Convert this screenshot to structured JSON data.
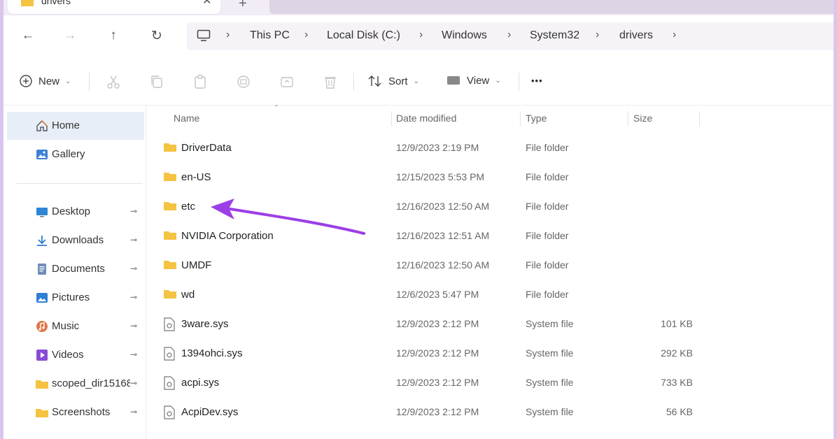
{
  "window": {
    "tab_title": "drivers",
    "tab_close": "✕",
    "tab_new": "+"
  },
  "nav": {
    "back_icon": "←",
    "forward_icon": "→",
    "up_icon": "↑",
    "refresh_icon": "↻",
    "separator": "›",
    "breadcrumbs": [
      "This PC",
      "Local Disk (C:)",
      "Windows",
      "System32",
      "drivers"
    ]
  },
  "toolbar": {
    "new_label": "New",
    "sort_label": "Sort",
    "view_label": "View",
    "more_label": "•••",
    "caret": "⌄"
  },
  "sidebar": {
    "items": [
      {
        "label": "Home",
        "icon": "home-icon",
        "pinned": false
      },
      {
        "label": "Gallery",
        "icon": "gallery-icon",
        "pinned": false
      },
      {
        "label": "Desktop",
        "icon": "desktop-icon",
        "pinned": true
      },
      {
        "label": "Downloads",
        "icon": "downloads-icon",
        "pinned": true
      },
      {
        "label": "Documents",
        "icon": "documents-icon",
        "pinned": true
      },
      {
        "label": "Pictures",
        "icon": "pictures-icon",
        "pinned": true
      },
      {
        "label": "Music",
        "icon": "music-icon",
        "pinned": true
      },
      {
        "label": "Videos",
        "icon": "videos-icon",
        "pinned": true
      },
      {
        "label": "scoped_dir15168",
        "icon": "folder-icon",
        "pinned": true
      },
      {
        "label": "Screenshots",
        "icon": "folder-icon",
        "pinned": true
      }
    ],
    "pin_glyph": "📌"
  },
  "columns": {
    "name": "Name",
    "date": "Date modified",
    "type": "Type",
    "size": "Size"
  },
  "files": [
    {
      "name": "DriverData",
      "date": "12/9/2023 2:19 PM",
      "type": "File folder",
      "size": "",
      "kind": "folder"
    },
    {
      "name": "en-US",
      "date": "12/15/2023 5:53 PM",
      "type": "File folder",
      "size": "",
      "kind": "folder"
    },
    {
      "name": "etc",
      "date": "12/16/2023 12:50 AM",
      "type": "File folder",
      "size": "",
      "kind": "folder"
    },
    {
      "name": "NVIDIA Corporation",
      "date": "12/16/2023 12:51 AM",
      "type": "File folder",
      "size": "",
      "kind": "folder"
    },
    {
      "name": "UMDF",
      "date": "12/16/2023 12:50 AM",
      "type": "File folder",
      "size": "",
      "kind": "folder"
    },
    {
      "name": "wd",
      "date": "12/6/2023 5:47 PM",
      "type": "File folder",
      "size": "",
      "kind": "folder"
    },
    {
      "name": "3ware.sys",
      "date": "12/9/2023 2:12 PM",
      "type": "System file",
      "size": "101 KB",
      "kind": "file"
    },
    {
      "name": "1394ohci.sys",
      "date": "12/9/2023 2:12 PM",
      "type": "System file",
      "size": "292 KB",
      "kind": "file"
    },
    {
      "name": "acpi.sys",
      "date": "12/9/2023 2:12 PM",
      "type": "System file",
      "size": "733 KB",
      "kind": "file"
    },
    {
      "name": "AcpiDev.sys",
      "date": "12/9/2023 2:12 PM",
      "type": "System file",
      "size": "56 KB",
      "kind": "file"
    }
  ],
  "colors": {
    "accent_arrow": "#9b3fe6",
    "folder": "#f5c342",
    "selected_bg": "#e8eef8",
    "frame": "#d9c6ec"
  }
}
